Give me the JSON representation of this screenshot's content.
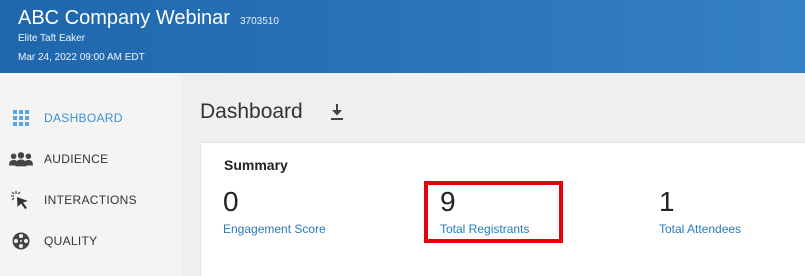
{
  "header": {
    "title": "ABC Company Webinar",
    "webinar_id": "3703510",
    "presenter": "Elite Taft Eaker",
    "datetime": "Mar 24, 2022 09:00 AM EDT"
  },
  "sidebar": {
    "items": [
      {
        "label": "DASHBOARD",
        "icon": "grid-icon",
        "active": true
      },
      {
        "label": "AUDIENCE",
        "icon": "users-icon",
        "active": false
      },
      {
        "label": "INTERACTIONS",
        "icon": "cursor-click-icon",
        "active": false
      },
      {
        "label": "QUALITY",
        "icon": "film-reel-icon",
        "active": false
      }
    ]
  },
  "main": {
    "page_title": "Dashboard",
    "download_icon": "download-icon",
    "summary": {
      "title": "Summary",
      "metrics": [
        {
          "value": "0",
          "label": "Engagement Score"
        },
        {
          "value": "9",
          "label": "Total Registrants"
        },
        {
          "value": "1",
          "label": "Total Attendees"
        }
      ]
    }
  },
  "colors": {
    "header_start": "#1f67ad",
    "header_end": "#3581c4",
    "active_nav": "#3d8fd3",
    "metric_link": "#2a7ab8",
    "highlight_box": "#e8000b"
  }
}
